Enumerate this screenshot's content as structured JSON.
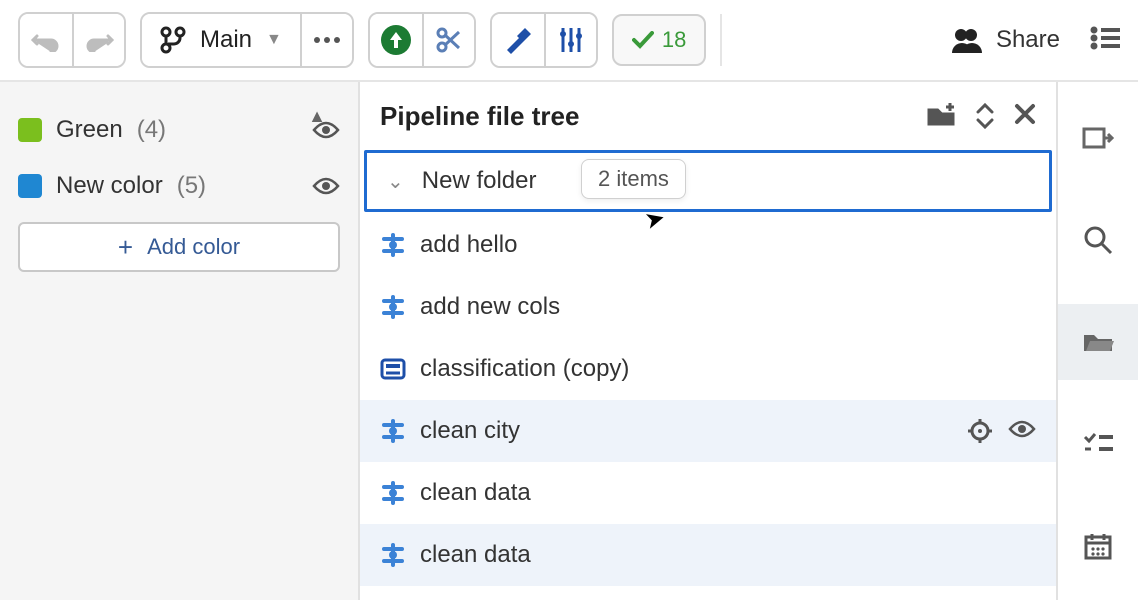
{
  "toolbar": {
    "branch_label": "Main",
    "status_count": "18",
    "share_label": "Share"
  },
  "sidebar": {
    "colors": [
      {
        "name": "Green",
        "count": "(4)",
        "swatch": "#7bbf1e"
      },
      {
        "name": "New color",
        "count": "(5)",
        "swatch": "#1f87d2"
      }
    ],
    "add_label": "Add color"
  },
  "tree": {
    "title": "Pipeline file tree",
    "folder_label": "New folder",
    "folder_tooltip": "2 items",
    "items": [
      {
        "label": "add hello",
        "type": "recipe"
      },
      {
        "label": "add new cols",
        "type": "recipe"
      },
      {
        "label": "classification (copy)",
        "type": "node"
      },
      {
        "label": "clean city",
        "type": "recipe",
        "hovered": true
      },
      {
        "label": "clean data",
        "type": "recipe"
      },
      {
        "label": "clean data",
        "type": "recipe",
        "hovered": true
      }
    ]
  }
}
